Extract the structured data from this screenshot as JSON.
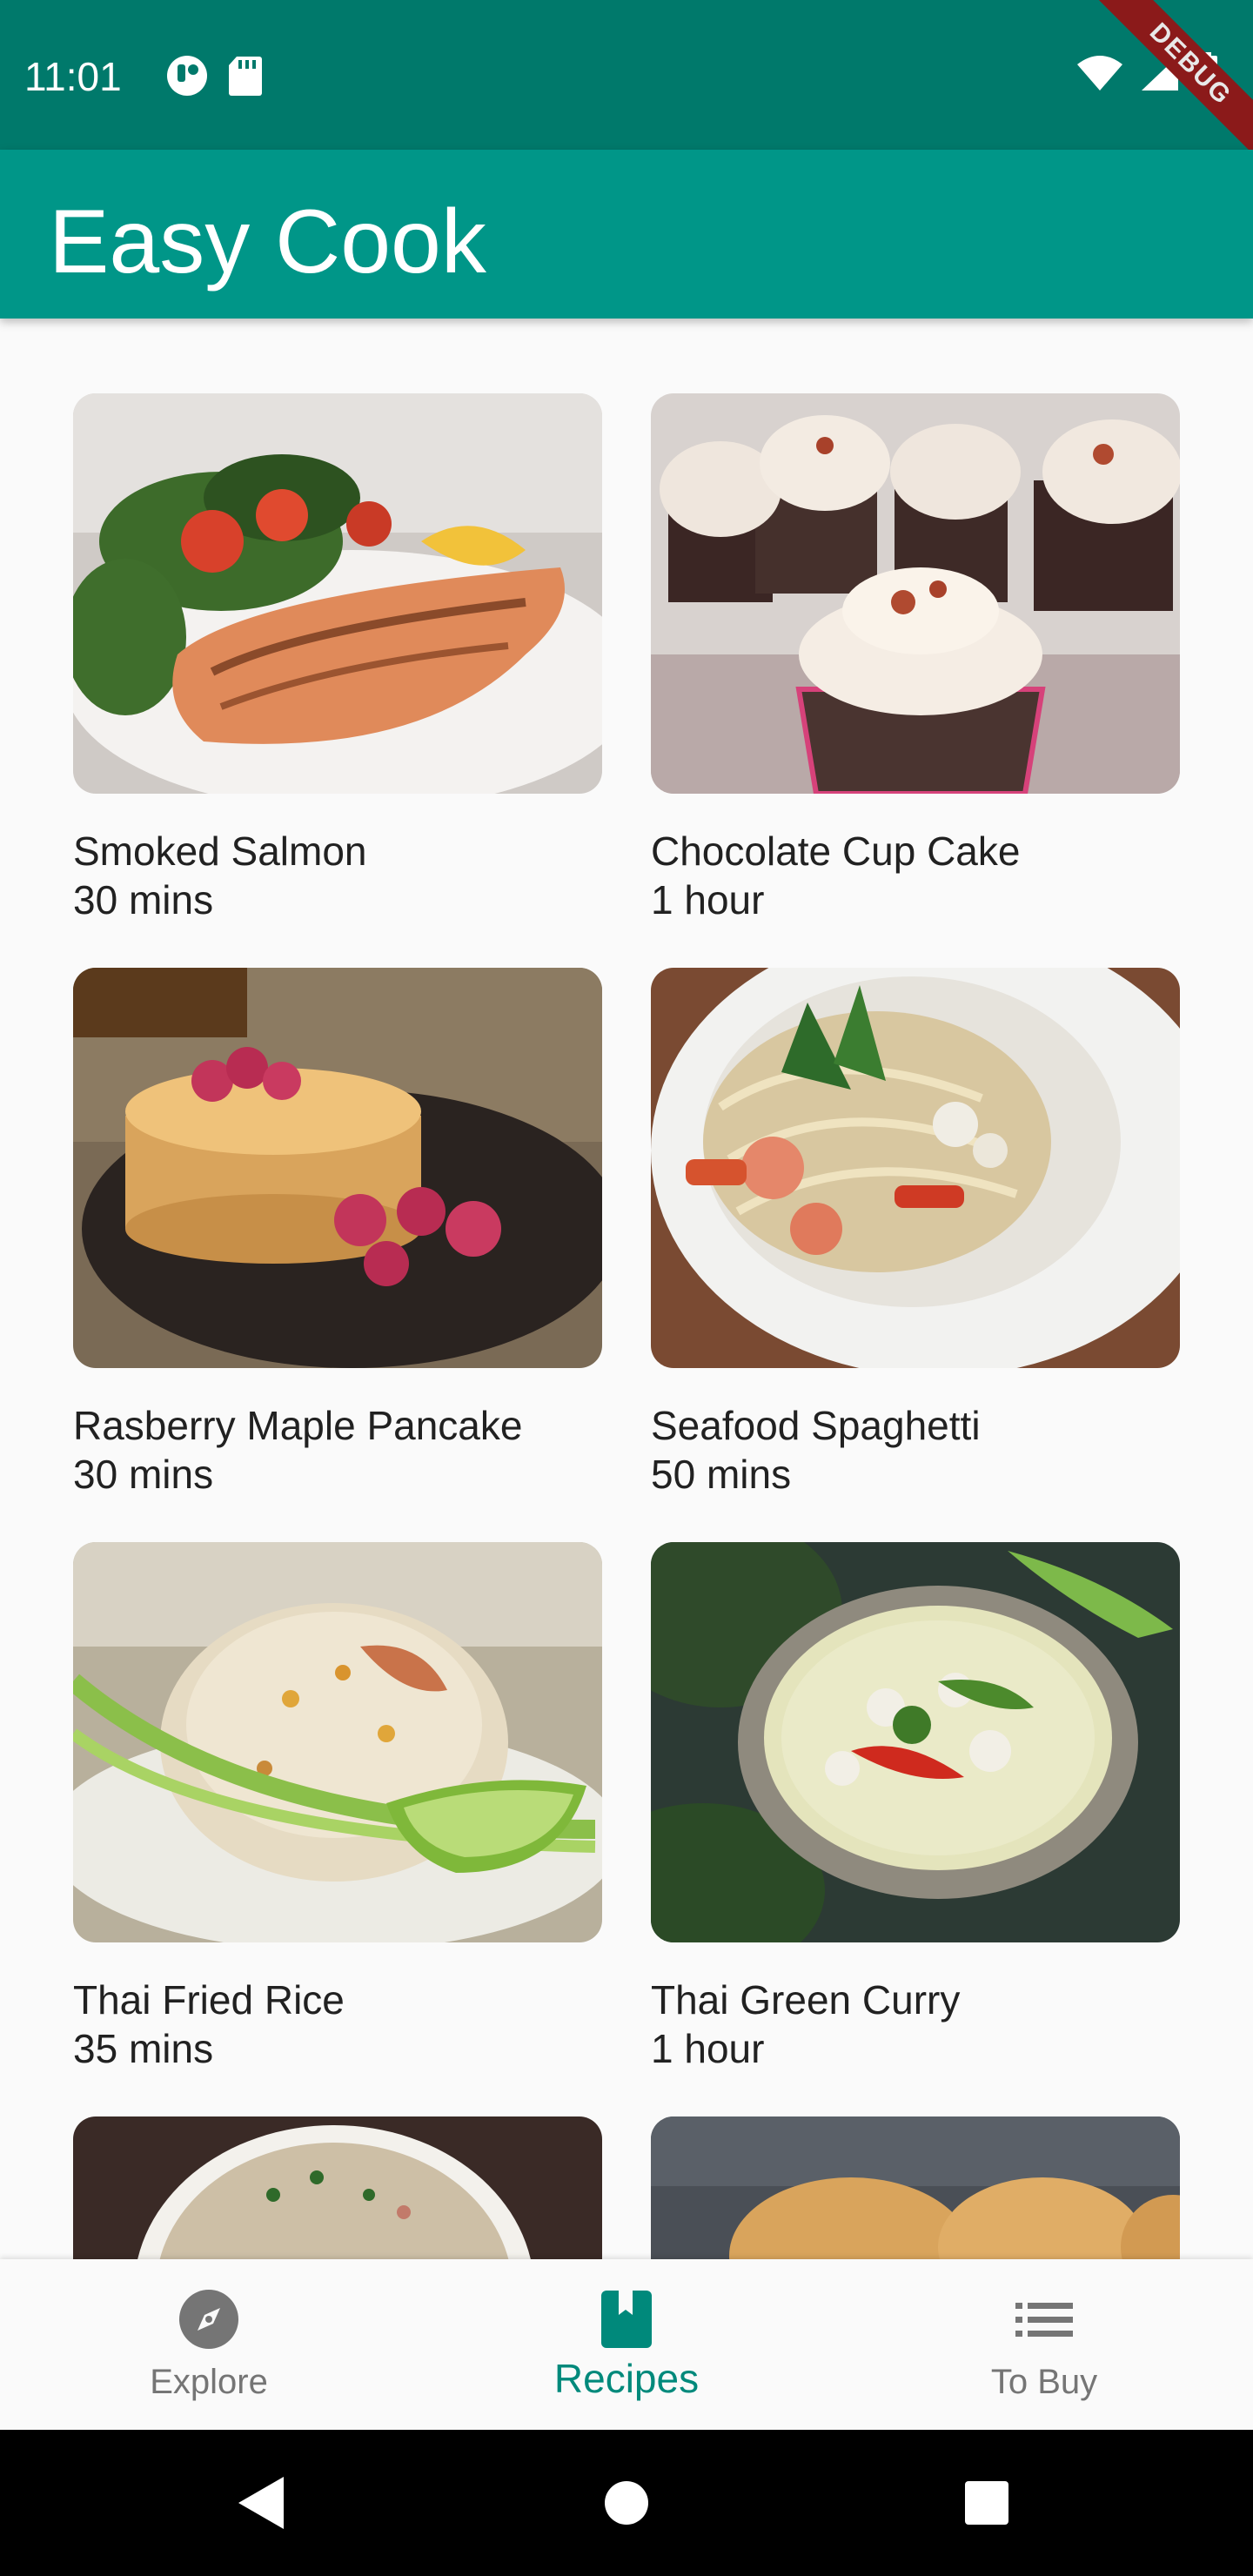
{
  "status_bar": {
    "time": "11:01",
    "left_icons": [
      "app-notification-icon",
      "sd-card-icon"
    ],
    "right_icons": [
      "wifi-icon",
      "signal-icon",
      "battery-icon"
    ],
    "debug_label": "DEBUG"
  },
  "app_bar": {
    "title": "Easy Cook"
  },
  "recipes": [
    {
      "title": "Smoked Salmon",
      "time": "30 mins"
    },
    {
      "title": "Chocolate Cup Cake",
      "time": "1 hour"
    },
    {
      "title": "Rasberry Maple Pancake",
      "time": "30 mins"
    },
    {
      "title": "Seafood Spaghetti",
      "time": "50 mins"
    },
    {
      "title": "Thai Fried Rice",
      "time": "35 mins"
    },
    {
      "title": "Thai Green Curry",
      "time": "1 hour"
    }
  ],
  "bottom_nav": {
    "items": [
      {
        "label": "Explore",
        "icon": "compass-icon"
      },
      {
        "label": "Recipes",
        "icon": "book-icon"
      },
      {
        "label": "To Buy",
        "icon": "list-icon"
      }
    ],
    "active_index": 1
  },
  "colors": {
    "status_bar": "#00796b",
    "app_bar": "#009688",
    "accent": "#00897b"
  },
  "system_nav": {
    "icons": [
      "back-icon",
      "home-icon",
      "recents-icon"
    ]
  }
}
